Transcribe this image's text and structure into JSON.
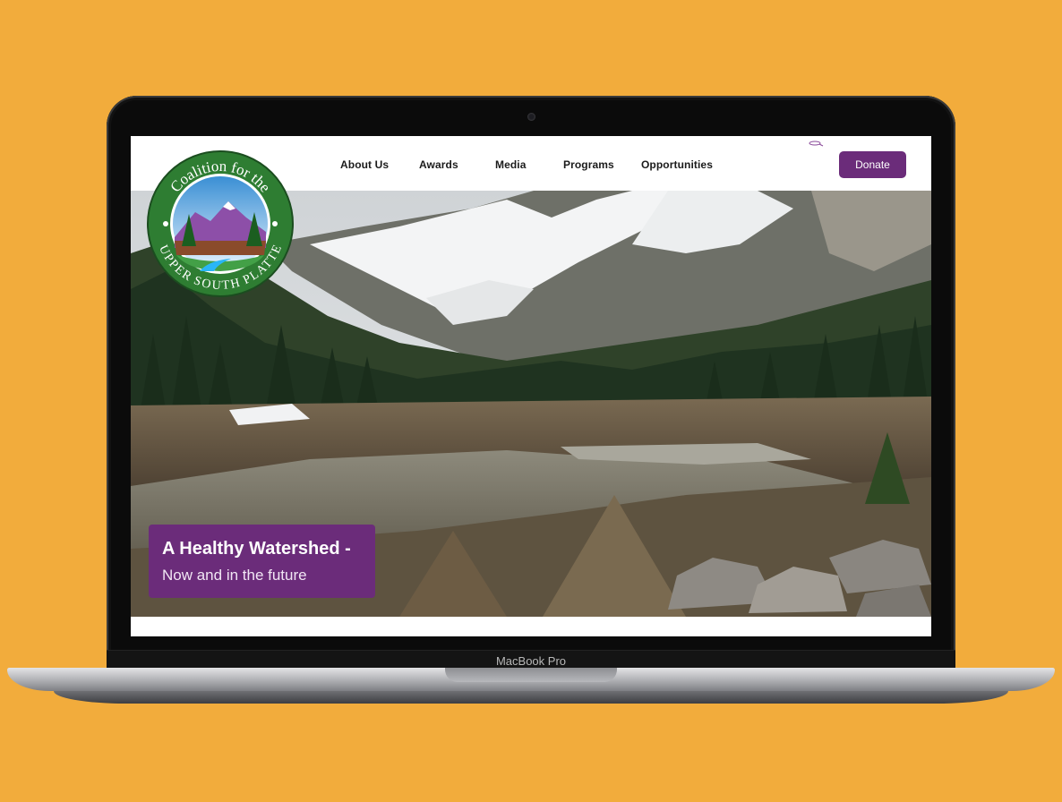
{
  "nav": {
    "items": [
      {
        "label": "About Us"
      },
      {
        "label": "Awards"
      },
      {
        "label": "Media"
      },
      {
        "label": "Programs"
      },
      {
        "label": "Opportunities"
      }
    ],
    "donate_label": "Donate"
  },
  "logo": {
    "top_text": "Coalition for the",
    "bottom_text": "UPPER SOUTH PLATTE"
  },
  "hero": {
    "title": "A Healthy Watershed -",
    "subtitle": "Now and in the future"
  },
  "device": {
    "model_label": "MacBook Pro"
  },
  "colors": {
    "background": "#F2AC3C",
    "brand_purple": "#6B2C7A",
    "logo_green": "#2E7D32"
  },
  "icons": [
    "search-icon",
    "camera-icon"
  ]
}
